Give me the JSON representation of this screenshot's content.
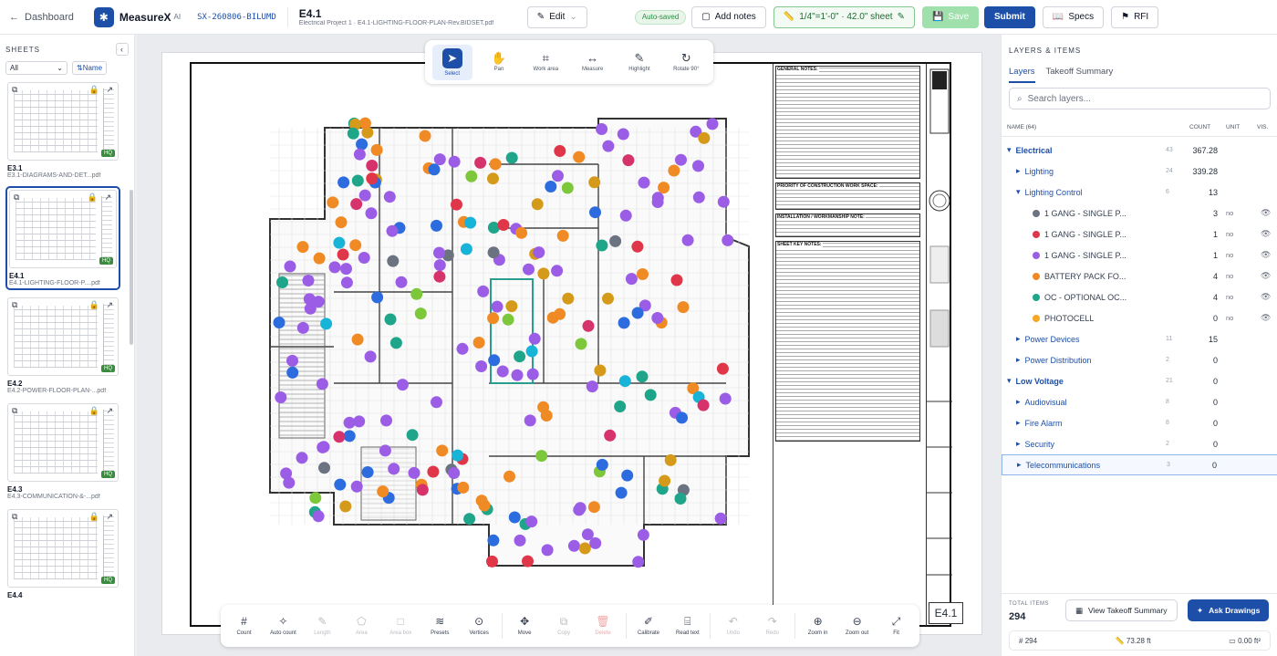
{
  "topbar": {
    "back_label": "Dashboard",
    "brand": "MeasureX",
    "brand_suffix": "AI",
    "project_code": "SX-260806-BILUMD",
    "sheet_title": "E4.1",
    "sheet_subtitle": "Electrical Project 1 · E4.1-LIGHTING-FLOOR-PLAN-Rev.BIDSET.pdf",
    "edit_label": "Edit",
    "autosaved_label": "Auto-saved",
    "add_notes_label": "Add notes",
    "scale_label": "1/4\"=1'-0\" · 42.0\" sheet",
    "save_label": "Save",
    "submit_label": "Submit",
    "specs_label": "Specs",
    "rfi_label": "RFI"
  },
  "sheets_panel": {
    "header": "SHEETS",
    "filter_value": "All",
    "sort_label": "Name",
    "sheets": [
      {
        "name": "E3.1",
        "file": "E3.1-DIAGRAMS-AND-DET...pdf",
        "badge": "HQ",
        "active": false
      },
      {
        "name": "E4.1",
        "file": "E4.1-LIGHTING-FLOOR-P....pdf",
        "badge": "HQ",
        "active": true
      },
      {
        "name": "E4.2",
        "file": "E4.2-POWER-FLOOR-PLAN-...pdf",
        "badge": "HQ",
        "active": false
      },
      {
        "name": "E4.3",
        "file": "E4.3-COMMUNICATION-&-...pdf",
        "badge": "HQ",
        "active": false
      },
      {
        "name": "E4.4",
        "file": "",
        "badge": "HQ",
        "active": false
      }
    ]
  },
  "drawing": {
    "notes_general": "GENERAL NOTES:",
    "notes_priority": "PRIORITY OF CONSTRUCTION WORK SPACE:",
    "notes_install": "INSTALLATION / WORKMANSHIP NOTE:",
    "notes_sheet": "SHEET KEY NOTES:",
    "sheet_number": "E4.1"
  },
  "top_tools": [
    {
      "label": "Select",
      "icon": "cursor-icon",
      "glyph": "➤",
      "active": true
    },
    {
      "label": "Pan",
      "icon": "hand-icon",
      "glyph": "✋",
      "active": false
    },
    {
      "label": "Work area",
      "icon": "crop-icon",
      "glyph": "⌗",
      "active": false
    },
    {
      "label": "Measure",
      "icon": "measure-icon",
      "glyph": "↔",
      "active": false
    },
    {
      "label": "Highlight",
      "icon": "highlighter-icon",
      "glyph": "✎",
      "active": false
    },
    {
      "label": "Rotate 90°",
      "icon": "rotate-icon",
      "glyph": "↻",
      "active": false
    }
  ],
  "bottom_tools": [
    {
      "label": "Count",
      "icon": "hash-icon",
      "glyph": "#",
      "state": "on"
    },
    {
      "label": "Auto count",
      "icon": "sparkle-icon",
      "glyph": "✧",
      "state": "on"
    },
    {
      "label": "Length",
      "icon": "pencil-icon",
      "glyph": "✎",
      "state": "dis"
    },
    {
      "label": "Area",
      "icon": "pentagon-icon",
      "glyph": "⬠",
      "state": "dis"
    },
    {
      "label": "Area box",
      "icon": "square-icon",
      "glyph": "□",
      "state": "dis"
    },
    {
      "label": "Presets",
      "icon": "layers-icon",
      "glyph": "≋",
      "state": "on"
    },
    {
      "label": "Vertices",
      "icon": "vertex-icon",
      "glyph": "⊙",
      "state": "on"
    },
    {
      "label": "Move",
      "icon": "move-icon",
      "glyph": "✥",
      "state": "on"
    },
    {
      "label": "Copy",
      "icon": "copy-icon",
      "glyph": "⧉",
      "state": "dis"
    },
    {
      "label": "Delete",
      "icon": "trash-icon",
      "glyph": "🗑",
      "state": "del"
    },
    {
      "label": "Calibrate",
      "icon": "calibrate-icon",
      "glyph": "✐",
      "state": "on"
    },
    {
      "label": "Read text",
      "icon": "scan-text-icon",
      "glyph": "⌸",
      "state": "on"
    },
    {
      "label": "Undo",
      "icon": "undo-icon",
      "glyph": "↶",
      "state": "dis"
    },
    {
      "label": "Redo",
      "icon": "redo-icon",
      "glyph": "↷",
      "state": "dis"
    },
    {
      "label": "Zoom in",
      "icon": "zoom-in-icon",
      "glyph": "⊕",
      "state": "on"
    },
    {
      "label": "Zoom out",
      "icon": "zoom-out-icon",
      "glyph": "⊖",
      "state": "on"
    },
    {
      "label": "Fit",
      "icon": "fit-icon",
      "glyph": "⤢",
      "state": "on"
    }
  ],
  "layers_panel": {
    "header": "LAYERS & ITEMS",
    "tab_layers": "Layers",
    "tab_summary": "Takeoff Summary",
    "search_placeholder": "Search layers...",
    "col_name": "NAME (64)",
    "col_count": "COUNT",
    "col_unit": "UNIT",
    "col_vis": "VIS.",
    "rows": [
      {
        "level": 0,
        "caret": "▾",
        "name": "Electrical",
        "sub": "43",
        "count": "367.28",
        "unit": "",
        "vis": false,
        "color": ""
      },
      {
        "level": 1,
        "caret": "▸",
        "name": "Lighting",
        "sub": "24",
        "count": "339.28",
        "unit": "",
        "vis": false,
        "color": ""
      },
      {
        "level": 1,
        "caret": "▾",
        "name": "Lighting Control",
        "sub": "6",
        "count": "13",
        "unit": "",
        "vis": false,
        "color": ""
      },
      {
        "level": 2,
        "caret": "",
        "name": "1 GANG - SINGLE P...",
        "sub": "",
        "count": "3",
        "unit": "no",
        "vis": true,
        "color": "#6b7280"
      },
      {
        "level": 2,
        "caret": "",
        "name": "1 GANG - SINGLE P...",
        "sub": "",
        "count": "1",
        "unit": "no",
        "vis": true,
        "color": "#e0364a"
      },
      {
        "level": 2,
        "caret": "",
        "name": "1 GANG - SINGLE P...",
        "sub": "",
        "count": "1",
        "unit": "no",
        "vis": true,
        "color": "#9b5de5"
      },
      {
        "level": 2,
        "caret": "",
        "name": "BATTERY PACK FO...",
        "sub": "",
        "count": "4",
        "unit": "no",
        "vis": true,
        "color": "#f08a24"
      },
      {
        "level": 2,
        "caret": "",
        "name": "OC - OPTIONAL OC...",
        "sub": "",
        "count": "4",
        "unit": "no",
        "vis": true,
        "color": "#1ea58a"
      },
      {
        "level": 2,
        "caret": "",
        "name": "PHOTOCELL",
        "sub": "",
        "count": "0",
        "unit": "no",
        "vis": true,
        "color": "#f5a623"
      },
      {
        "level": 1,
        "caret": "▸",
        "name": "Power Devices",
        "sub": "11",
        "count": "15",
        "unit": "",
        "vis": false,
        "color": ""
      },
      {
        "level": 1,
        "caret": "▸",
        "name": "Power Distribution",
        "sub": "2",
        "count": "0",
        "unit": "",
        "vis": false,
        "color": ""
      },
      {
        "level": 0,
        "caret": "▾",
        "name": "Low Voltage",
        "sub": "21",
        "count": "0",
        "unit": "",
        "vis": false,
        "color": ""
      },
      {
        "level": 1,
        "caret": "▸",
        "name": "Audiovisual",
        "sub": "8",
        "count": "0",
        "unit": "",
        "vis": false,
        "color": ""
      },
      {
        "level": 1,
        "caret": "▸",
        "name": "Fire Alarm",
        "sub": "8",
        "count": "0",
        "unit": "",
        "vis": false,
        "color": ""
      },
      {
        "level": 1,
        "caret": "▸",
        "name": "Security",
        "sub": "2",
        "count": "0",
        "unit": "",
        "vis": false,
        "color": ""
      },
      {
        "level": 1,
        "caret": "▸",
        "name": "Telecommunications",
        "sub": "3",
        "count": "0",
        "unit": "",
        "vis": false,
        "color": "",
        "highlight": true
      }
    ],
    "total_label": "TOTAL ITEMS",
    "total_value": "294",
    "view_summary_label": "View Takeoff Summary",
    "ask_label": "Ask Drawings",
    "stat_count": "294",
    "stat_length": "73.28 ft",
    "stat_area": "0.00 ft²"
  },
  "colors": {
    "accent": "#1e4fa8",
    "markers": [
      "#9b5de5",
      "#f08a24",
      "#1ea58a",
      "#e0364a",
      "#2d6cdf",
      "#18b4d8",
      "#d69a1a",
      "#7cc73a",
      "#6b7280",
      "#d6336c"
    ]
  }
}
